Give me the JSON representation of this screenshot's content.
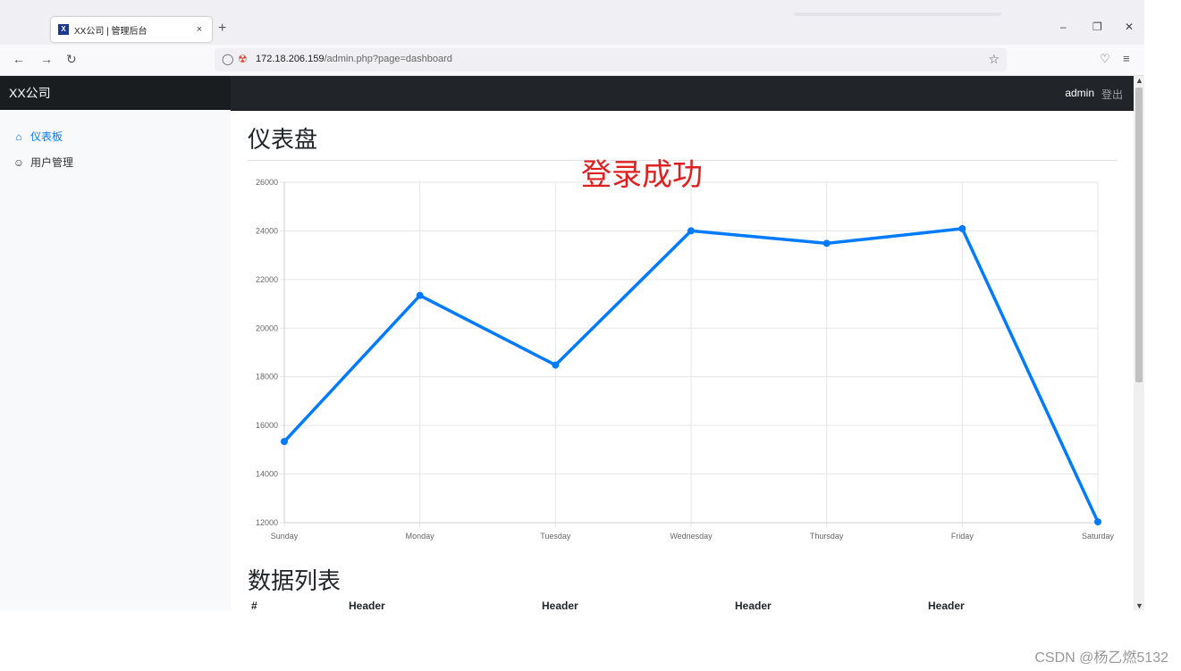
{
  "browser": {
    "tab_title": "XX公司 | 管理后台",
    "tab_close": "×",
    "favicon_letter": "X",
    "new_tab": "+",
    "url_host": "172.18.206.159",
    "url_path": "/admin.php?page=dashboard",
    "icons": [
      "back-arrow-icon",
      "forward-arrow-icon",
      "reload-icon",
      "shield-icon",
      "insecure-lock-icon",
      "star-icon",
      "pocket-icon",
      "menu-icon"
    ]
  },
  "app": {
    "brand": "XX公司",
    "user": "admin",
    "logout": "登出"
  },
  "sidebar": {
    "items": [
      {
        "label": "仪表板",
        "icon": "house-icon",
        "active": true
      },
      {
        "label": "用户管理",
        "icon": "people-icon",
        "active": false
      }
    ]
  },
  "main": {
    "title": "仪表盘",
    "overlay": "登录成功",
    "list_title": "数据列表",
    "table_headers": [
      "#",
      "Header",
      "Header",
      "Header",
      "Header"
    ]
  },
  "chart_data": {
    "type": "line",
    "categories": [
      "Sunday",
      "Monday",
      "Tuesday",
      "Wednesday",
      "Thursday",
      "Friday",
      "Saturday"
    ],
    "values": [
      15339,
      21345,
      18483,
      24003,
      23489,
      24092,
      12034
    ],
    "ylim": [
      12000,
      26000
    ],
    "yticks": [
      12000,
      14000,
      16000,
      18000,
      20000,
      22000,
      24000,
      26000
    ],
    "color": "#007bff",
    "grid": true
  },
  "watermark": "CSDN @杨乙燃5132",
  "colors": {
    "accent": "#007bff",
    "success_text": "#e02020",
    "navbar": "#212529"
  }
}
